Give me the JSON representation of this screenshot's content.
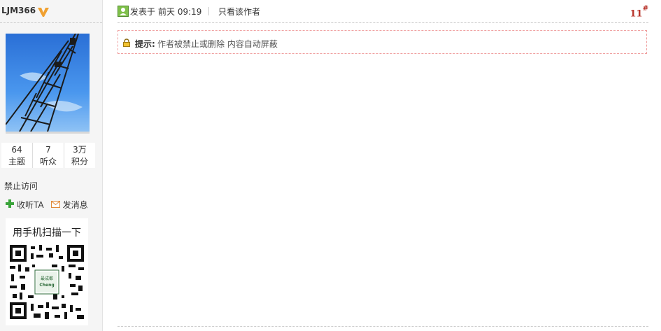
{
  "user": {
    "username": "LJM366",
    "verified_badge": "v-badge-icon",
    "avatar": "avatar-image",
    "stats": [
      {
        "value": "64",
        "label": "主题"
      },
      {
        "value": "7",
        "label": "听众"
      },
      {
        "value": "3万",
        "label": "积分"
      }
    ],
    "status": "禁止访问",
    "actions": {
      "follow_label": "收听TA",
      "message_label": "发消息"
    },
    "qr": {
      "title": "用手机扫描一下",
      "center_text": "最成都",
      "center_sub": "Cheng"
    }
  },
  "post": {
    "posted_label": "发表于",
    "posted_time": "前天 09:19",
    "only_author_label": "只看该作者",
    "floor": "11",
    "floor_suffix": "#",
    "notice_label": "提示:",
    "notice_text": "作者被禁止或删除 内容自动屏蔽"
  },
  "colors": {
    "floor": "#b8342b",
    "notice_border": "#f0a0a0",
    "follow_icon": "#3aa33a",
    "badge": "#f0a030"
  }
}
